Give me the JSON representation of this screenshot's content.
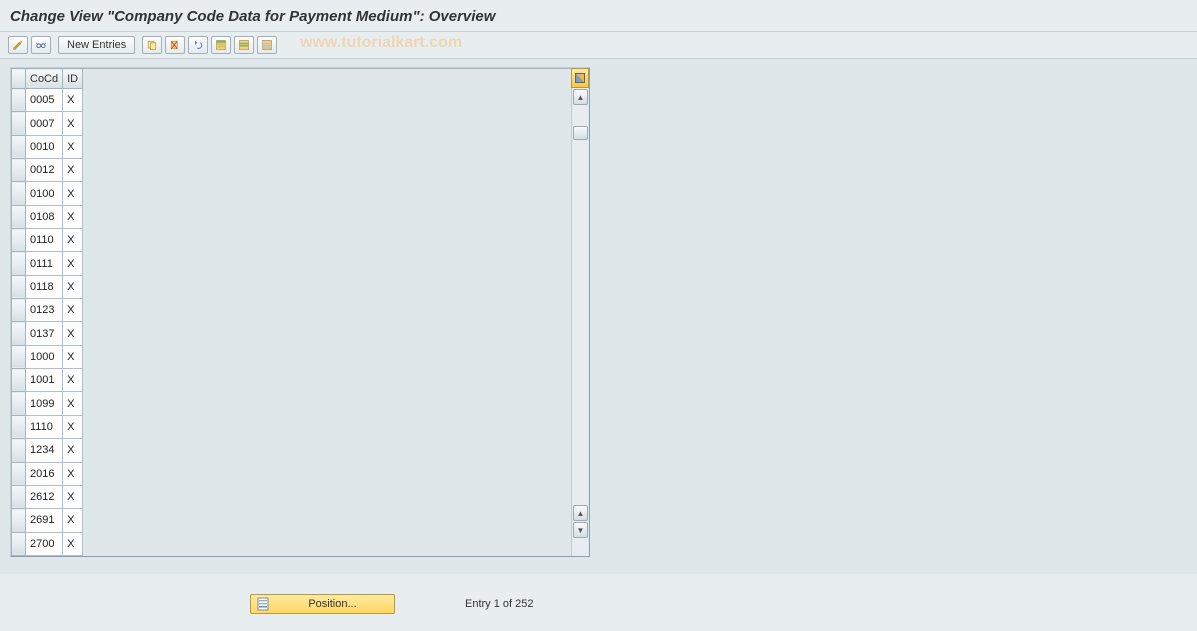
{
  "title": "Change View \"Company Code Data for Payment Medium\": Overview",
  "watermark": "www.tutorialkart.com",
  "toolbar": {
    "new_entries": "New Entries"
  },
  "table": {
    "headers": {
      "cocd": "CoCd",
      "id": "ID"
    },
    "rows": [
      {
        "cocd": "0005",
        "id": "X"
      },
      {
        "cocd": "0007",
        "id": "X"
      },
      {
        "cocd": "0010",
        "id": "X"
      },
      {
        "cocd": "0012",
        "id": "X"
      },
      {
        "cocd": "0100",
        "id": "X"
      },
      {
        "cocd": "0108",
        "id": "X"
      },
      {
        "cocd": "0110",
        "id": "X"
      },
      {
        "cocd": "0111",
        "id": "X"
      },
      {
        "cocd": "0118",
        "id": "X"
      },
      {
        "cocd": "0123",
        "id": "X"
      },
      {
        "cocd": "0137",
        "id": "X"
      },
      {
        "cocd": "1000",
        "id": "X"
      },
      {
        "cocd": "1001",
        "id": "X"
      },
      {
        "cocd": "1099",
        "id": "X"
      },
      {
        "cocd": "1110",
        "id": "X"
      },
      {
        "cocd": "1234",
        "id": "X"
      },
      {
        "cocd": "2016",
        "id": "X"
      },
      {
        "cocd": "2612",
        "id": "X"
      },
      {
        "cocd": "2691",
        "id": "X"
      },
      {
        "cocd": "2700",
        "id": "X"
      }
    ]
  },
  "footer": {
    "position_label": "Position...",
    "entry_text": "Entry 1 of 252"
  }
}
